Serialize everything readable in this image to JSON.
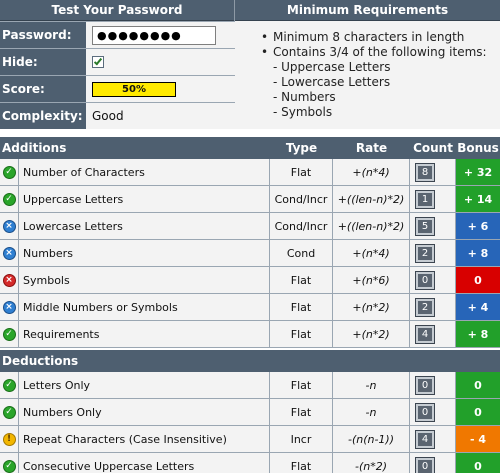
{
  "test_panel": {
    "title": "Test Your Password",
    "password_label": "Password:",
    "password_value": "●●●●●●●●",
    "hide_label": "Hide:",
    "hide_checked": true,
    "score_label": "Score:",
    "score_value": "50%",
    "score_fraction": 0.5,
    "complexity_label": "Complexity:",
    "complexity_value": "Good"
  },
  "requirements_panel": {
    "title": "Minimum Requirements",
    "items": [
      "Minimum 8 characters in length",
      "Contains 3/4 of the following items:"
    ],
    "sub_items": [
      "- Uppercase Letters",
      "- Lowercase Letters",
      "- Numbers",
      "- Symbols"
    ]
  },
  "table_headers": {
    "additions": "Additions",
    "type": "Type",
    "rate": "Rate",
    "count": "Count",
    "bonus": "Bonus",
    "deductions": "Deductions"
  },
  "additions": [
    {
      "status": "ok",
      "name": "Number of Characters",
      "type": "Flat",
      "rate": "+(n*4)",
      "count": "8",
      "bonus": "+ 32",
      "bonus_color": "#22a02a"
    },
    {
      "status": "ok",
      "name": "Uppercase Letters",
      "type": "Cond/Incr",
      "rate": "+((len-n)*2)",
      "count": "1",
      "bonus": "+ 14",
      "bonus_color": "#22a02a"
    },
    {
      "status": "info",
      "name": "Lowercase Letters",
      "type": "Cond/Incr",
      "rate": "+((len-n)*2)",
      "count": "5",
      "bonus": "+ 6",
      "bonus_color": "#2765b8"
    },
    {
      "status": "info",
      "name": "Numbers",
      "type": "Cond",
      "rate": "+(n*4)",
      "count": "2",
      "bonus": "+ 8",
      "bonus_color": "#2765b8"
    },
    {
      "status": "fail",
      "name": "Symbols",
      "type": "Flat",
      "rate": "+(n*6)",
      "count": "0",
      "bonus": "0",
      "bonus_color": "#d80000"
    },
    {
      "status": "info",
      "name": "Middle Numbers or Symbols",
      "type": "Flat",
      "rate": "+(n*2)",
      "count": "2",
      "bonus": "+ 4",
      "bonus_color": "#2765b8"
    },
    {
      "status": "ok",
      "name": "Requirements",
      "type": "Flat",
      "rate": "+(n*2)",
      "count": "4",
      "bonus": "+ 8",
      "bonus_color": "#22a02a"
    }
  ],
  "deductions": [
    {
      "status": "ok",
      "name": "Letters Only",
      "type": "Flat",
      "rate": "-n",
      "count": "0",
      "bonus": "0",
      "bonus_color": "#22a02a"
    },
    {
      "status": "ok",
      "name": "Numbers Only",
      "type": "Flat",
      "rate": "-n",
      "count": "0",
      "bonus": "0",
      "bonus_color": "#22a02a"
    },
    {
      "status": "warn",
      "name": "Repeat Characters (Case Insensitive)",
      "type": "Incr",
      "rate": "-(n(n-1))",
      "count": "4",
      "bonus": "- 4",
      "bonus_color": "#f07800"
    },
    {
      "status": "ok",
      "name": "Consecutive Uppercase Letters",
      "type": "Flat",
      "rate": "-(n*2)",
      "count": "0",
      "bonus": "0",
      "bonus_color": "#22a02a"
    }
  ]
}
